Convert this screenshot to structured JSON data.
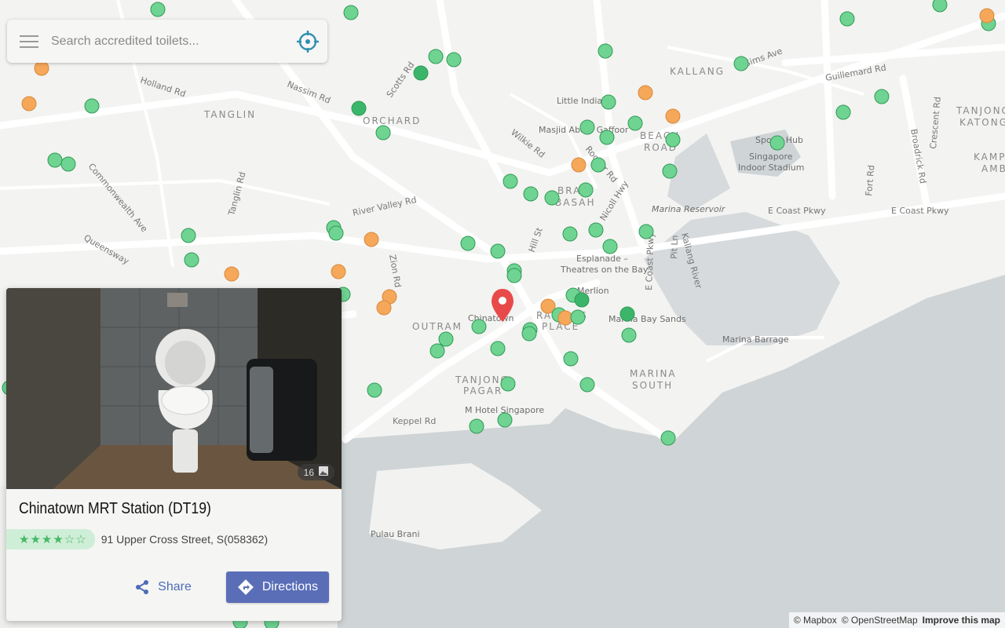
{
  "search": {
    "placeholder": "Search accredited toilets..."
  },
  "map": {
    "districts": [
      "TANGLIN",
      "ORCHARD",
      "KALLANG",
      "OUTRAM",
      "TANJONG PAGAR",
      "MARINA SOUTH",
      "TANJONG KATONG",
      "BEACH ROAD",
      "BRAS BASAH",
      "RAFFLES PLACE",
      "KAMPONG AMBER"
    ],
    "roads": [
      "Holland Rd",
      "Nassim Rd",
      "Scotts Rd",
      "Commonwealth Ave",
      "Tanglin Rd",
      "Queensway",
      "River Valley Rd",
      "Zion Rd",
      "Wilkie Rd",
      "Rochor Rd",
      "Nicoll Hwy",
      "Hill St",
      "Kallang River",
      "E Coast Pkwy",
      "Pit Ln",
      "Fort Rd",
      "Guillemard Rd",
      "Sims Ave",
      "Crescent Rd",
      "Broadrick Rd",
      "Keppel Rd"
    ],
    "places": [
      "Little India",
      "Masjid Abdul Gaffoor",
      "Sports Hub",
      "Singapore Indoor Stadium",
      "Marina Reservoir",
      "Esplanade – Theatres on the Bay",
      "Merlion",
      "Chinatown",
      "Marina Bay Sands",
      "Marina Barrage",
      "M Hotel Singapore",
      "Pulau Brani"
    ],
    "marker_colors": {
      "accredited": "#6fd392",
      "accredited_dark": "#3bb56a",
      "pending": "#f5a75a",
      "pin": "#e84a4a"
    }
  },
  "card": {
    "title": "Chinatown MRT Station (DT19)",
    "rating": "★★★★☆☆",
    "address": "91 Upper Cross Street, S(058362)",
    "photo_count": "16",
    "share_label": "Share",
    "directions_label": "Directions"
  },
  "attribution": {
    "mapbox": "© Mapbox",
    "osm": "© OpenStreetMap",
    "improve": "Improve this map"
  }
}
